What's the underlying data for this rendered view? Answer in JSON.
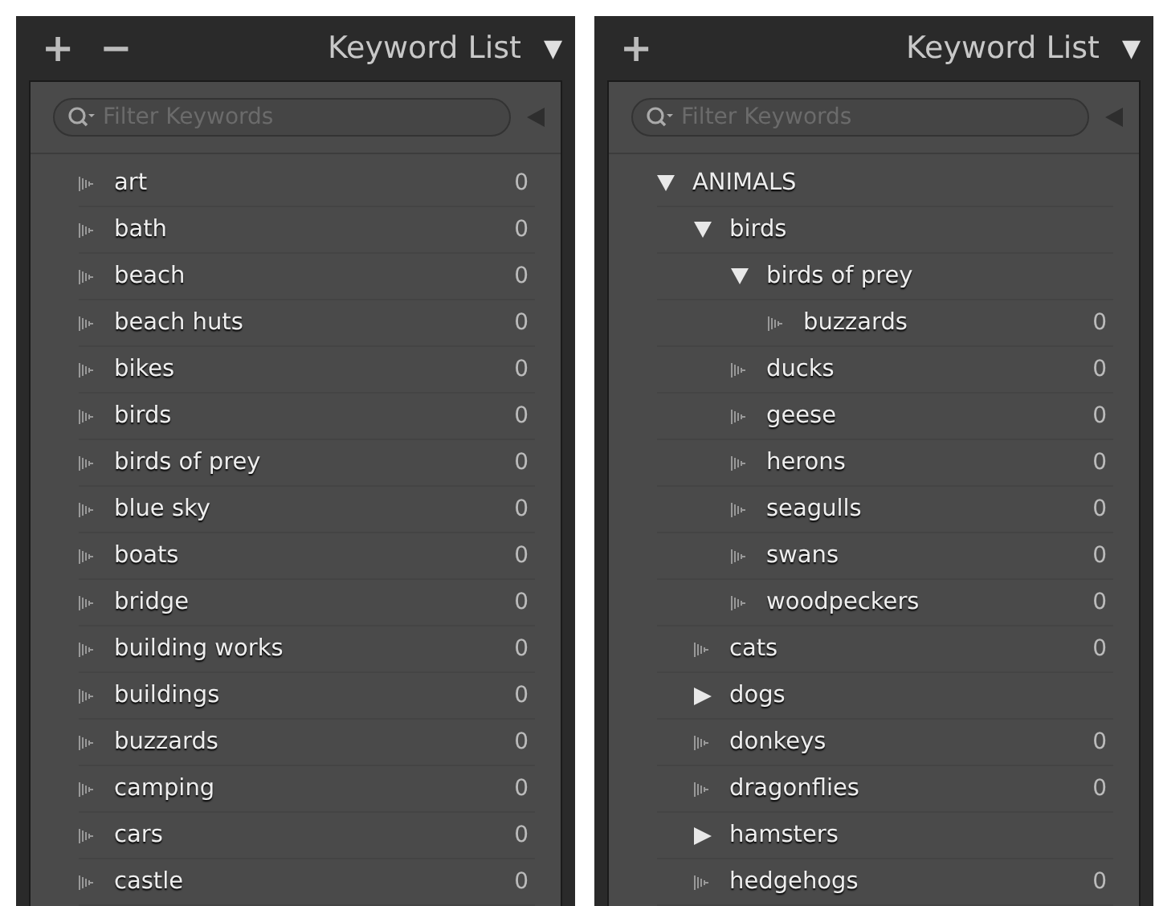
{
  "panels": [
    {
      "header_buttons": [
        "+",
        "−"
      ],
      "title": "Keyword List",
      "collapse_icon": "▼",
      "filter": {
        "placeholder": "Filter Keywords"
      },
      "keywords": [
        {
          "label": "art",
          "kind": "leaf",
          "count": "0"
        },
        {
          "label": "bath",
          "kind": "leaf",
          "count": "0"
        },
        {
          "label": "beach",
          "kind": "leaf",
          "count": "0"
        },
        {
          "label": "beach huts",
          "kind": "leaf",
          "count": "0"
        },
        {
          "label": "bikes",
          "kind": "leaf",
          "count": "0"
        },
        {
          "label": "birds",
          "kind": "leaf",
          "count": "0"
        },
        {
          "label": "birds of prey",
          "kind": "leaf",
          "count": "0"
        },
        {
          "label": "blue sky",
          "kind": "leaf",
          "count": "0"
        },
        {
          "label": "boats",
          "kind": "leaf",
          "count": "0"
        },
        {
          "label": "bridge",
          "kind": "leaf",
          "count": "0"
        },
        {
          "label": "building works",
          "kind": "leaf",
          "count": "0"
        },
        {
          "label": "buildings",
          "kind": "leaf",
          "count": "0"
        },
        {
          "label": "buzzards",
          "kind": "leaf",
          "count": "0"
        },
        {
          "label": "camping",
          "kind": "leaf",
          "count": "0"
        },
        {
          "label": "cars",
          "kind": "leaf",
          "count": "0"
        },
        {
          "label": "castle",
          "kind": "leaf",
          "count": "0"
        }
      ]
    },
    {
      "header_buttons": [
        "+"
      ],
      "title": "Keyword List",
      "collapse_icon": "▼",
      "filter": {
        "placeholder": "Filter Keywords"
      },
      "keywords": [
        {
          "label": "ANIMALS",
          "kind": "parent",
          "expanded": true,
          "children": [
            {
              "label": "birds",
              "kind": "parent",
              "expanded": true,
              "children": [
                {
                  "label": "birds of prey",
                  "kind": "parent",
                  "expanded": true,
                  "children": [
                    {
                      "label": "buzzards",
                      "kind": "leaf",
                      "count": "0"
                    }
                  ]
                },
                {
                  "label": "ducks",
                  "kind": "leaf",
                  "count": "0"
                },
                {
                  "label": "geese",
                  "kind": "leaf",
                  "count": "0"
                },
                {
                  "label": "herons",
                  "kind": "leaf",
                  "count": "0"
                },
                {
                  "label": "seagulls",
                  "kind": "leaf",
                  "count": "0"
                },
                {
                  "label": "swans",
                  "kind": "leaf",
                  "count": "0"
                },
                {
                  "label": "woodpeckers",
                  "kind": "leaf",
                  "count": "0"
                }
              ]
            },
            {
              "label": "cats",
              "kind": "leaf",
              "count": "0"
            },
            {
              "label": "dogs",
              "kind": "parent",
              "expanded": false
            },
            {
              "label": "donkeys",
              "kind": "leaf",
              "count": "0"
            },
            {
              "label": "dragonflies",
              "kind": "leaf",
              "count": "0"
            },
            {
              "label": "hamsters",
              "kind": "parent",
              "expanded": false
            },
            {
              "label": "hedgehogs",
              "kind": "leaf",
              "count": "0"
            }
          ]
        }
      ]
    }
  ]
}
